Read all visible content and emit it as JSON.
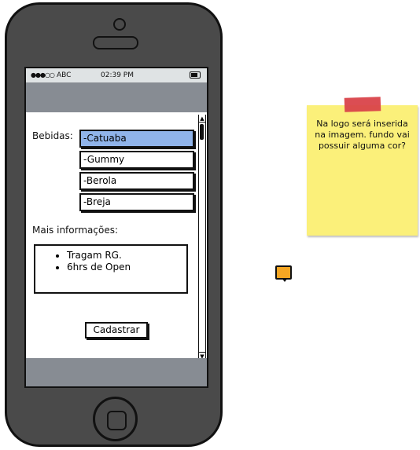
{
  "statusbar": {
    "signal": "●●●○○",
    "carrier": "ABC",
    "time": "02:39 PM"
  },
  "form": {
    "bebidas_label": "Bebidas:",
    "bebidas_options": [
      "-Catuaba",
      "-Gummy",
      "-Berola",
      "-Breja"
    ],
    "selected_option": "-Catuaba",
    "mais_label": "Mais informações:",
    "info_items": [
      "Tragam RG.",
      "6hrs de Open"
    ],
    "submit_label": "Cadastrar"
  },
  "sticky_note": {
    "text": "Na logo será inserida na imagem. fundo vai possuir alguma cor?"
  },
  "colors": {
    "selected_item": "#90b4ea",
    "navbar": "#878c93",
    "sticky": "#fbf07a",
    "tape": "#d9434a",
    "marker": "#f5a623"
  },
  "icons": {
    "scroll_up": "▲",
    "scroll_down": "▼"
  }
}
